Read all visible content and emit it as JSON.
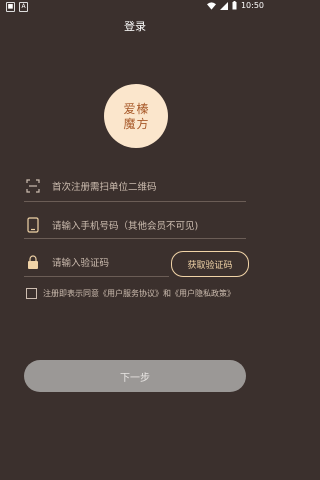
{
  "status": {
    "time": "10:50"
  },
  "page": {
    "title": "登录"
  },
  "logo": {
    "chars": [
      "爱",
      "榛",
      "魔",
      "方"
    ]
  },
  "form": {
    "scan_label": "首次注册需扫单位二维码",
    "phone_placeholder": "请输入手机号码（其他会员不可见)",
    "code_placeholder": "请输入验证码",
    "get_code_label": "获取验证码",
    "agreement_text": "注册即表示同意《用户服务协议》和《用户隐私政策》",
    "next_label": "下一步"
  },
  "colors": {
    "background": "#3b302d",
    "accent": "#f0d3a7",
    "logo_bg": "#fbe6cc",
    "logo_text": "#a85a2a",
    "disabled_button": "#9b9896"
  }
}
